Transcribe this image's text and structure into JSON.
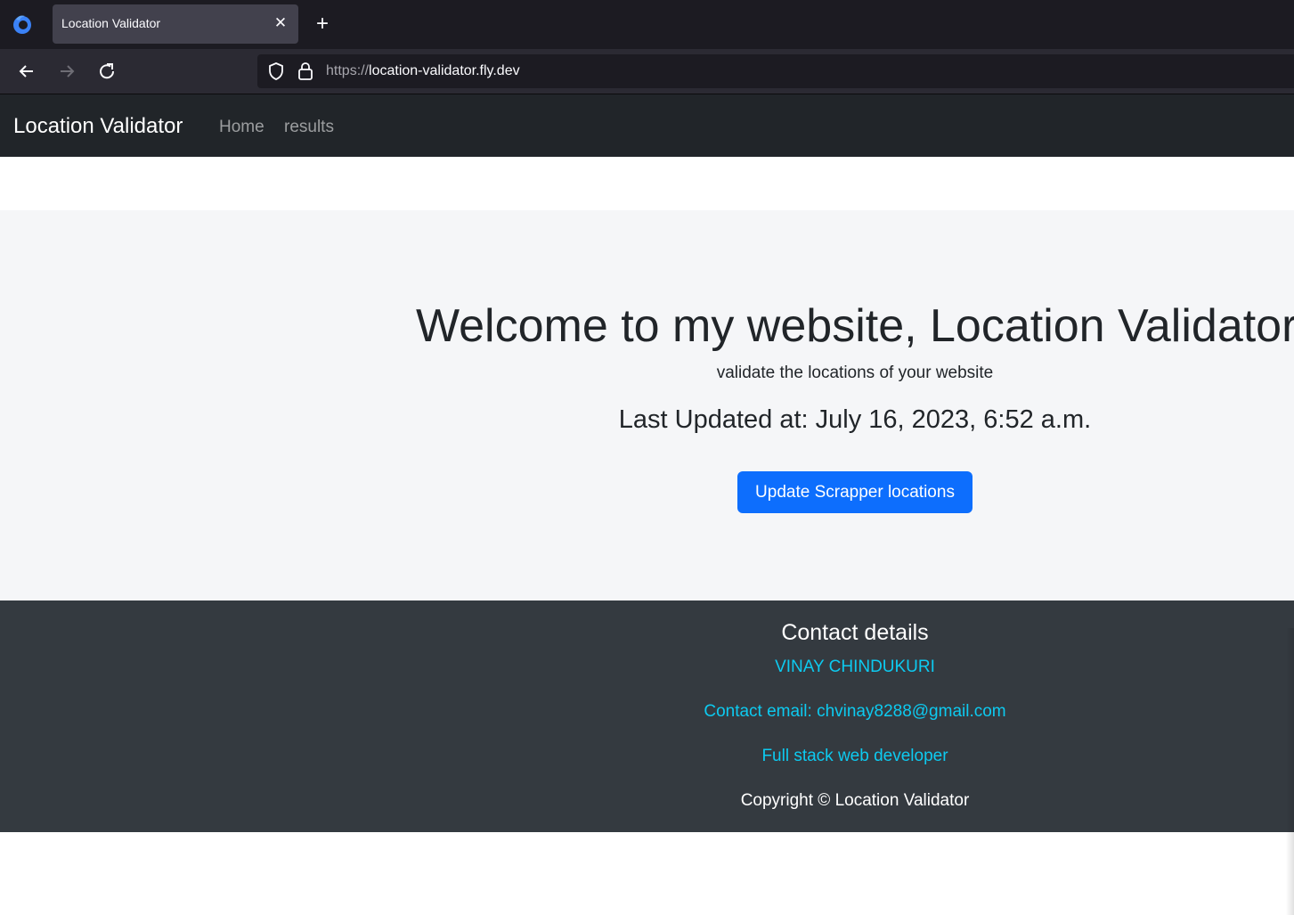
{
  "browser": {
    "tab_title": "Location Validator",
    "url_scheme": "https://",
    "url_host": "location-validator.fly.dev"
  },
  "site": {
    "brand": "Location Validator",
    "nav_links": [
      "Home",
      "results"
    ]
  },
  "hero": {
    "title": "Welcome to my website, Location Validator",
    "subtitle": "validate the locations of your website",
    "last_updated": "Last Updated at: July 16, 2023, 6:52 a.m.",
    "button_label": "Update Scrapper locations"
  },
  "footer": {
    "heading": "Contact details",
    "name": "VINAY CHINDUKURI",
    "email": "Contact email: chvinay8288@gmail.com",
    "role": "Full stack web developer",
    "copyright": "Copyright © Location Validator"
  },
  "colors": {
    "primary": "#0d6efd",
    "link": "#0dcaf0",
    "navbar": "#212529",
    "footer": "#343a40",
    "hero_bg": "#f5f6f8"
  }
}
